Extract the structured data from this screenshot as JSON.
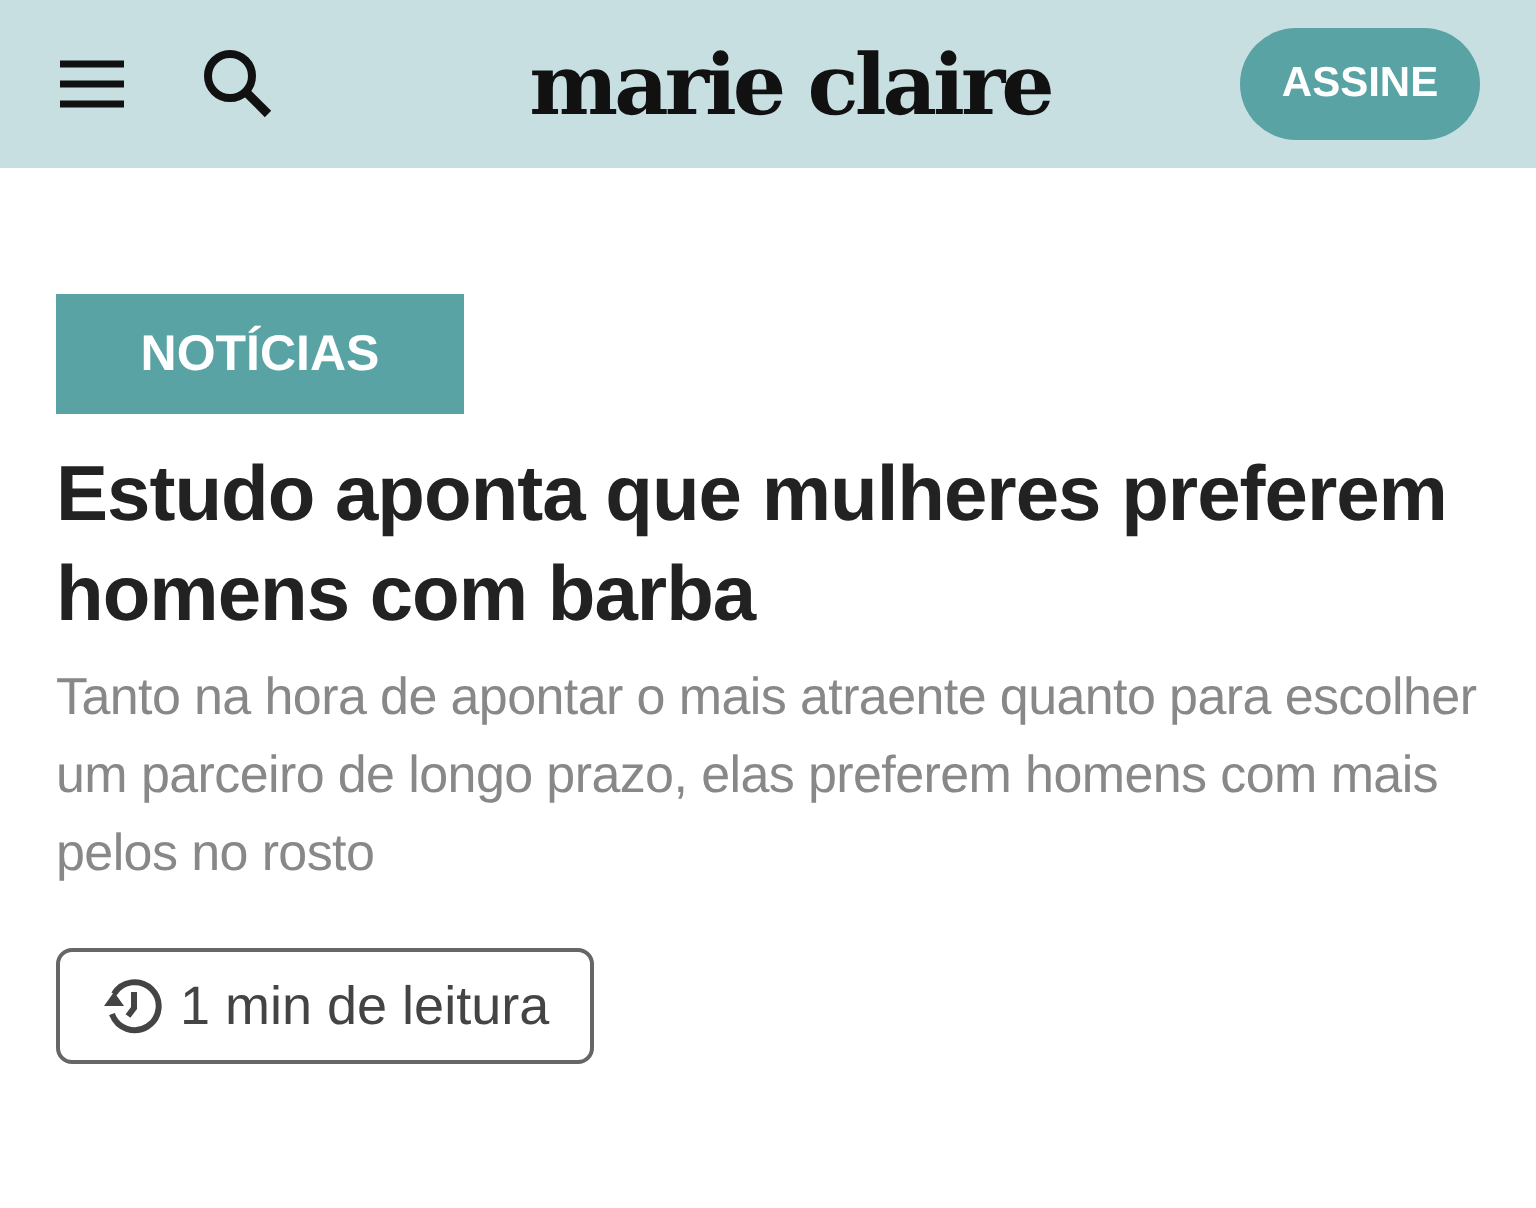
{
  "header": {
    "logo": "marie claire",
    "subscribe_button": "ASSINE"
  },
  "article": {
    "category": "NOTÍCIAS",
    "title": "Estudo aponta que mulheres preferem homens com barba",
    "subtitle": "Tanto na hora de apontar o mais atraente quanto para escolher um parceiro de longo prazo, elas preferem homens com mais pelos no rosto",
    "reading_time": "1 min de leitura"
  }
}
